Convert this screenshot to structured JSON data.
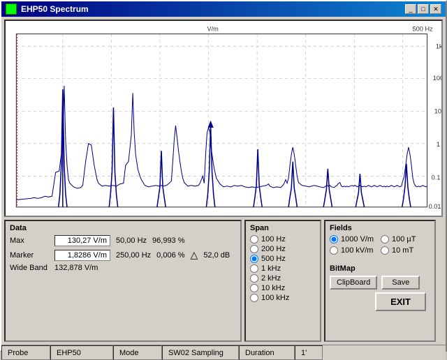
{
  "window": {
    "title": "EHP50  Spectrum",
    "min_btn": "_",
    "max_btn": "□",
    "close_btn": "✕"
  },
  "chart": {
    "y_label": "V/m",
    "y_axis_right": [
      "1k",
      "100",
      "10",
      "1",
      "0.1",
      "0.01"
    ],
    "x_axis_top": "500 Hz",
    "peaks": [
      {
        "x": 0.08,
        "h": 0.62,
        "label": ""
      },
      {
        "x": 0.165,
        "h": 0.52,
        "label": ""
      },
      {
        "x": 0.235,
        "h": 0.34,
        "label": ""
      },
      {
        "x": 0.295,
        "h": 0.29,
        "label": ""
      },
      {
        "x": 0.37,
        "h": 0.55,
        "label": "marker"
      },
      {
        "x": 0.44,
        "h": 0.38,
        "label": ""
      },
      {
        "x": 0.54,
        "h": 0.3,
        "label": ""
      },
      {
        "x": 0.625,
        "h": 0.26,
        "label": ""
      },
      {
        "x": 0.71,
        "h": 0.22,
        "label": ""
      },
      {
        "x": 0.8,
        "h": 0.24,
        "label": ""
      },
      {
        "x": 0.885,
        "h": 0.3,
        "label": ""
      },
      {
        "x": 0.965,
        "h": 0.36,
        "label": ""
      }
    ]
  },
  "data_section": {
    "title": "Data",
    "max_label": "Max",
    "max_value": "130,27 V/m",
    "max_freq": "50,00 Hz",
    "max_pct": "96,993 %",
    "marker_label": "Marker",
    "marker_value": "1,8286 V/m",
    "marker_freq": "250,00 Hz",
    "marker_pct": "0,006 %",
    "triangle": "△",
    "db_value": "52,0 dB",
    "wideband_label": "Wide Band",
    "wideband_value": "132,878 V/m"
  },
  "span_section": {
    "title": "Span",
    "options": [
      {
        "label": "100 Hz",
        "checked": false
      },
      {
        "label": "200 Hz",
        "checked": false
      },
      {
        "label": "500 Hz",
        "checked": true
      },
      {
        "label": "1 kHz",
        "checked": false
      },
      {
        "label": "2 kHz",
        "checked": false
      },
      {
        "label": "10 kHz",
        "checked": false
      },
      {
        "label": "100 kHz",
        "checked": false
      }
    ]
  },
  "fields_section": {
    "title": "Fields",
    "options": [
      {
        "label": "1000 V/m",
        "checked": true
      },
      {
        "label": "100 µT",
        "checked": false
      },
      {
        "label": "100 kV/m",
        "checked": false
      },
      {
        "label": "10 mT",
        "checked": false
      }
    ]
  },
  "bitmap_section": {
    "title": "BitMap",
    "clipboard_label": "ClipBoard",
    "save_label": "Save"
  },
  "exit_btn": "EXIT",
  "status_bar": {
    "probe": "Probe",
    "device": "EHP50",
    "mode": "Mode",
    "sampling": "SW02 Sampling",
    "duration": "Duration",
    "value": "1'"
  }
}
